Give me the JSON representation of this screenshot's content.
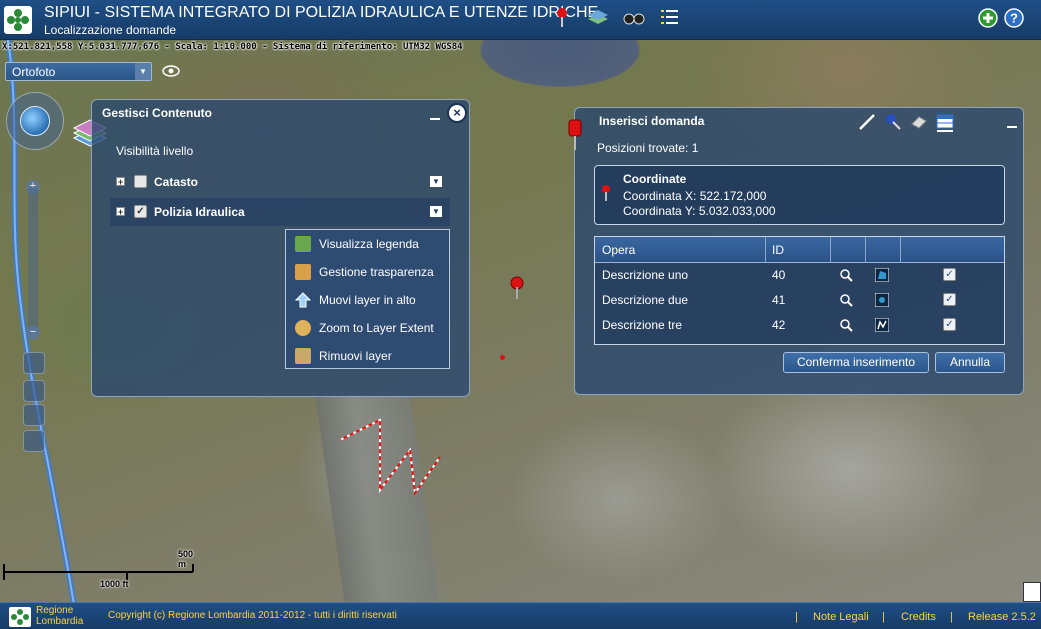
{
  "header": {
    "title": "SIPIUI - SISTEMA INTEGRATO DI POLIZIA IDRAULICA E UTENZE IDRICHE",
    "subtitle": "Localizzazione domande",
    "tools": [
      "pin-icon",
      "layers-icon",
      "binoculars-icon",
      "list-icon"
    ],
    "right_buttons": [
      "add-icon",
      "help-icon"
    ]
  },
  "coordbar": {
    "text": "X:521.821,558 Y:5.031.777,676 - Scala: 1:10.000 - Sistema di riferimento: UTM32 WGS84"
  },
  "basemap": {
    "selected": "Ortofoto"
  },
  "scale": {
    "metric": "500 m",
    "imperial": "1000 ft"
  },
  "gestisci": {
    "title": "Gestisci Contenuto",
    "visibility_label": "Visibilità livello",
    "layers": [
      {
        "name": "Catasto",
        "checked": false
      },
      {
        "name": "Polizia Idraulica",
        "checked": true
      }
    ],
    "context_menu": [
      {
        "label": "Visualizza legenda",
        "icon": "legend-icon"
      },
      {
        "label": "Gestione trasparenza",
        "icon": "transparency-icon"
      },
      {
        "label": "Muovi layer in alto",
        "icon": "arrow-up-icon"
      },
      {
        "label": "Zoom to Layer Extent",
        "icon": "zoom-extent-icon"
      },
      {
        "label": "Rimuovi layer",
        "icon": "remove-layer-icon"
      }
    ]
  },
  "inserisci": {
    "title": "Inserisci domanda",
    "tools": [
      "pencil-icon",
      "pin-edit-icon",
      "eraser-icon",
      "table-icon"
    ],
    "found": "Posizioni trovate: 1",
    "coord_title": "Coordinate",
    "coord_x": "Coordinata X: 522.172,000",
    "coord_y": "Coordinata Y: 5.032.033,000",
    "columns": [
      "Opera",
      "ID"
    ],
    "rows": [
      {
        "opera": "Descrizione uno",
        "id": "40",
        "checked": true
      },
      {
        "opera": "Descrizione due",
        "id": "41",
        "checked": true
      },
      {
        "opera": "Descrizione tre",
        "id": "42",
        "checked": true
      }
    ],
    "confirm_label": "Conferma inserimento",
    "cancel_label": "Annulla"
  },
  "footer": {
    "brand_line1": "Regione",
    "brand_line2": "Lombardia",
    "copyright": "Copyright (c) Regione Lombardia 2011-2012 - tutti i diritti riservati",
    "legal": "Note Legali",
    "credits": "Credits",
    "release": "Release 2.5.2",
    "separator": "|"
  },
  "colors": {
    "header_bg": "#1f4f86",
    "panel_bg": "#28466e",
    "footer_text": "#ffd23f",
    "pin_red": "#d11"
  }
}
